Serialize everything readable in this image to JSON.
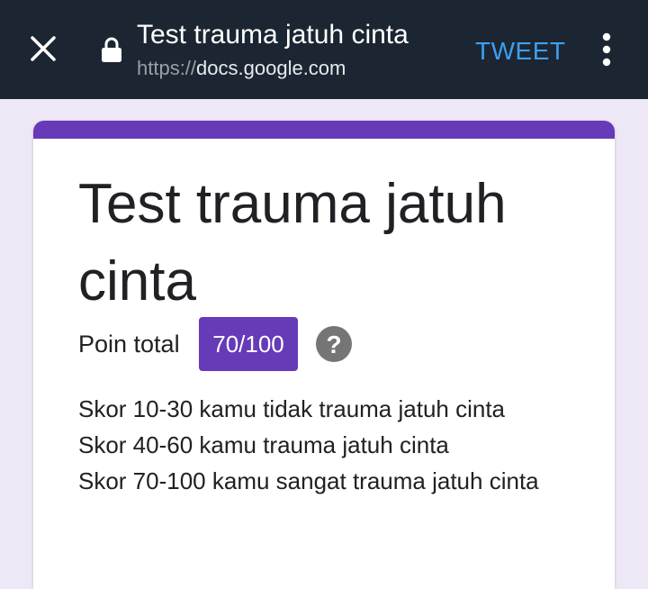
{
  "toolbar": {
    "title": "Test trauma jatuh cinta",
    "url_scheme": "https://",
    "url_host": "docs.google.com",
    "tweet_label": "TWEET",
    "close_icon": "close-icon",
    "lock_icon": "lock-icon",
    "more_icon": "more-vert-icon"
  },
  "form": {
    "title": "Test trauma jatuh cinta",
    "score_label": "Poin total",
    "score_value": "70/100",
    "help_icon": "help-circle-icon",
    "description": [
      "Skor 10-30 kamu tidak trauma jatuh cinta",
      "Skor 40-60 kamu trauma jatuh cinta",
      "Skor 70-100 kamu sangat trauma jatuh cinta"
    ]
  },
  "colors": {
    "toolbar_bg": "#1b2632",
    "accent": "#673ab7",
    "page_bg": "#ede7f6",
    "tweet": "#3d9ff0"
  }
}
